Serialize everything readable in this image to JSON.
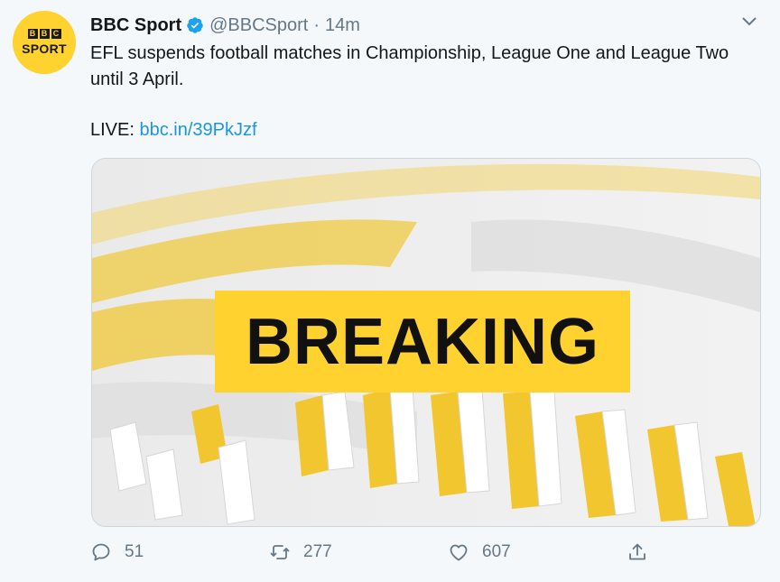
{
  "account": {
    "name": "BBC Sport",
    "handle": "@BBCSport",
    "separator": "·",
    "time": "14m",
    "avatar": {
      "logo_letters": [
        "B",
        "B",
        "C"
      ],
      "logo_word": "SPORT"
    }
  },
  "tweet": {
    "text": "EFL suspends football matches in Championship, League One and League Two until 3 April.",
    "live_prefix": "LIVE: ",
    "link": "bbc.in/39PkJzf"
  },
  "media": {
    "banner_text": "BREAKING"
  },
  "actions": {
    "replies": "51",
    "retweets": "277",
    "likes": "607"
  },
  "colors": {
    "brand_yellow": "#ffd230",
    "link_blue": "#1b95e0",
    "muted_gray": "#657786",
    "verified_blue": "#1da1f2"
  },
  "icons": [
    "bbc-sport-logo",
    "verified-badge-icon",
    "chevron-down-icon",
    "reply-icon",
    "retweet-icon",
    "like-icon",
    "share-icon"
  ]
}
